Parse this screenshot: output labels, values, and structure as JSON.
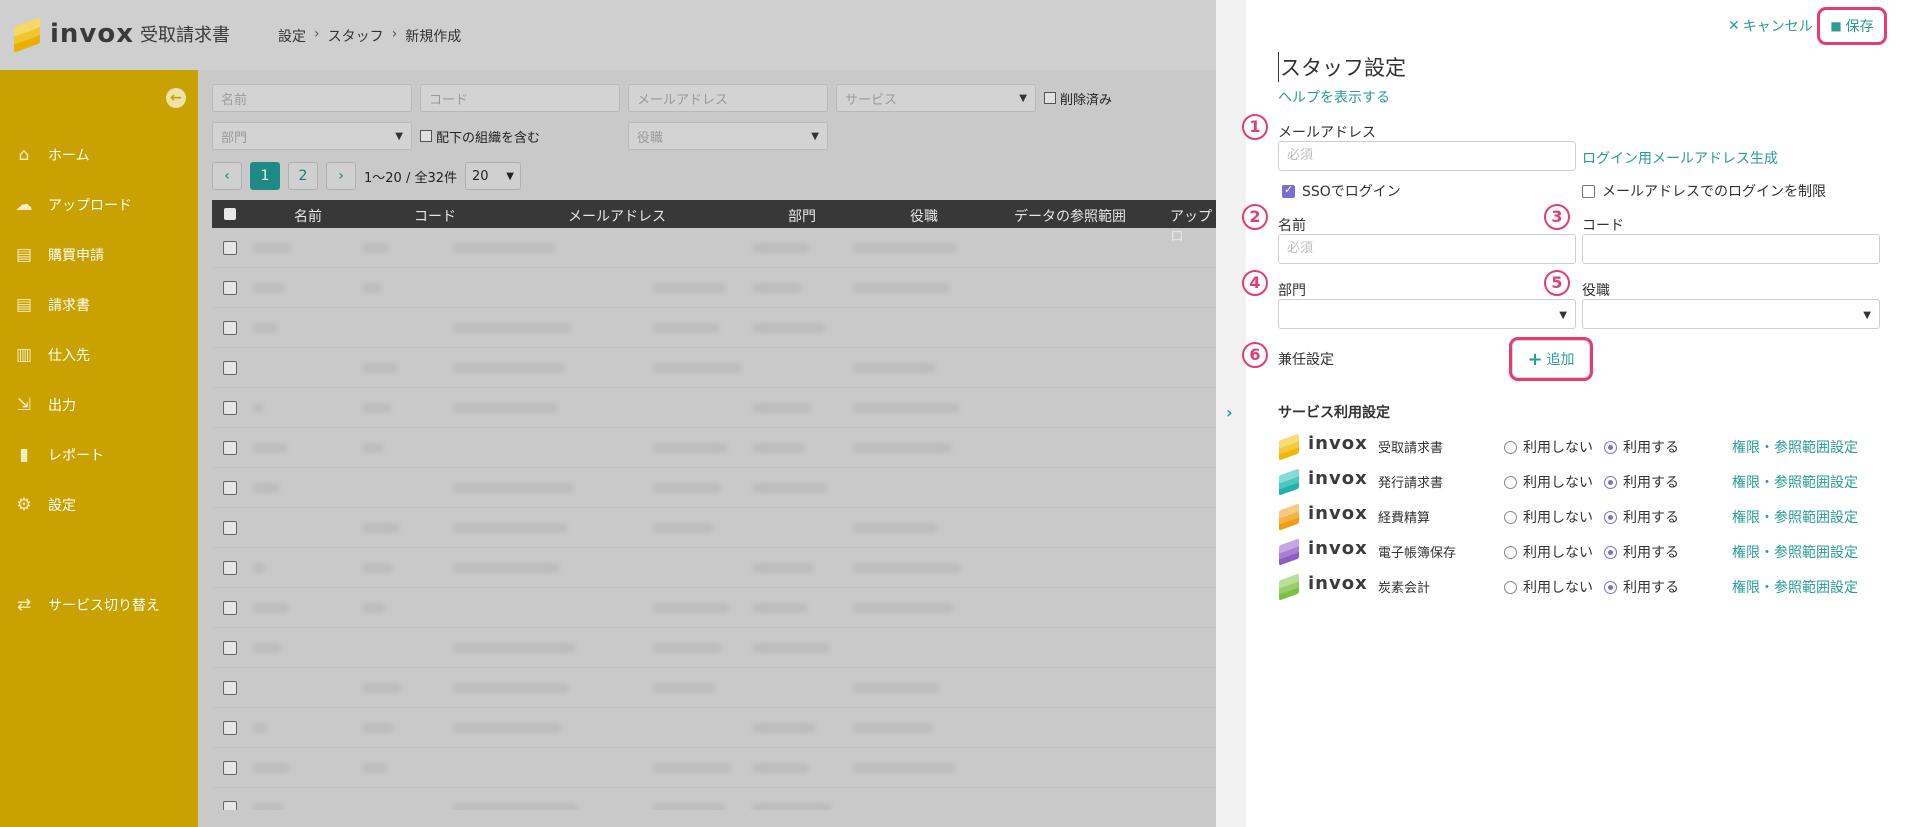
{
  "brand": {
    "word": "invox",
    "sub": "受取請求書"
  },
  "breadcrumb": [
    "設定",
    "スタッフ",
    "新規作成"
  ],
  "sidebar": {
    "items": [
      {
        "label": "ホーム",
        "icon": "home-icon",
        "glyph": "⌂"
      },
      {
        "label": "アップロード",
        "icon": "cloud-upload-icon",
        "glyph": "☁"
      },
      {
        "label": "購買申請",
        "icon": "document-icon",
        "glyph": "▤"
      },
      {
        "label": "請求書",
        "icon": "invoice-icon",
        "glyph": "▤"
      },
      {
        "label": "仕入先",
        "icon": "building-icon",
        "glyph": "▥"
      },
      {
        "label": "出力",
        "icon": "export-icon",
        "glyph": "⇲"
      },
      {
        "label": "レポート",
        "icon": "chart-icon",
        "glyph": "▮"
      },
      {
        "label": "設定",
        "icon": "gear-icon",
        "glyph": "⚙"
      }
    ],
    "switch_label": "サービス切り替え"
  },
  "filters": {
    "name_placeholder": "名前",
    "code_placeholder": "コード",
    "email_placeholder": "メールアドレス",
    "service_placeholder": "サービス",
    "deleted_label": "削除済み",
    "dept_placeholder": "部門",
    "subordinate_label": "配下の組織を含む",
    "role_placeholder": "役職"
  },
  "pager": {
    "pages": [
      "1",
      "2"
    ],
    "range": "1〜20 / 全32件",
    "per_page": "20"
  },
  "table": {
    "columns": [
      "名前",
      "コード",
      "メールアドレス",
      "部門",
      "役職",
      "データの参照範囲",
      "アップロ"
    ]
  },
  "panel": {
    "cancel_label": "キャンセル",
    "save_label": "保存",
    "title": "スタッフ設定",
    "help_link": "ヘルプを表示する",
    "markers": [
      "1",
      "2",
      "3",
      "4",
      "5",
      "6"
    ],
    "email_label": "メールアドレス",
    "email_placeholder": "必須",
    "email_generate_link": "ログイン用メールアドレス生成",
    "sso_label": "SSOでログイン",
    "sso_checked": true,
    "restrict_label": "メールアドレスでのログインを制限",
    "restrict_checked": false,
    "name_label": "名前",
    "name_placeholder": "必須",
    "code_label": "コード",
    "dept_label": "部門",
    "role_label": "役職",
    "concurrent_label": "兼任設定",
    "add_label": "追加",
    "services_heading": "サービス利用設定",
    "services": [
      {
        "name": "受取請求書",
        "colors": [
          "#f2b705",
          "#f5c93b",
          "#f8dc76"
        ],
        "off_label": "利用しない",
        "on_label": "利用する",
        "selected": "on",
        "link": "権限・参照範囲設定"
      },
      {
        "name": "発行請求書",
        "colors": [
          "#20b2aa",
          "#4cc7c0",
          "#86dbd5"
        ],
        "off_label": "利用しない",
        "on_label": "利用する",
        "selected": "on",
        "link": "権限・参照範囲設定"
      },
      {
        "name": "経費精算",
        "colors": [
          "#f39c12",
          "#f5b245",
          "#f8ca80"
        ],
        "off_label": "利用しない",
        "on_label": "利用する",
        "selected": "on",
        "link": "権限・参照範囲設定"
      },
      {
        "name": "電子帳簿保存",
        "colors": [
          "#8e5cc4",
          "#a77fd3",
          "#c3a8e3"
        ],
        "off_label": "利用しない",
        "on_label": "利用する",
        "selected": "on",
        "link": "権限・参照範囲設定"
      },
      {
        "name": "炭素会計",
        "colors": [
          "#7bc043",
          "#98cf6b",
          "#b9e09a"
        ],
        "off_label": "利用しない",
        "on_label": "利用する",
        "selected": "on",
        "link": "権限・参照範囲設定"
      }
    ]
  },
  "colors": {
    "accent": "#2a9d96",
    "sidebar": "#c9a100",
    "highlight": "#e23d74",
    "check": "#7b6fd0"
  }
}
